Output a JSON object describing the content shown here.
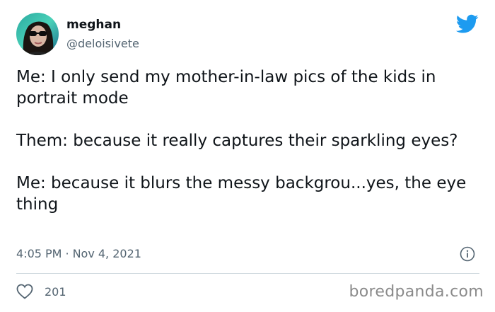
{
  "author": {
    "display_name": "meghan",
    "handle": "@deloisivete"
  },
  "tweet": {
    "paragraphs": [
      "Me: I only send my mother-in-law pics of the kids in portrait mode",
      "Them: because it really captures their sparkling eyes?",
      "Me: because it blurs the messy backgrou...yes, the eye thing"
    ],
    "time": "4:05 PM",
    "separator": "·",
    "date": "Nov 4, 2021"
  },
  "stats": {
    "likes": "201"
  },
  "watermark": "boredpanda.com",
  "colors": {
    "twitter_blue": "#1d9bf0",
    "secondary_text": "#536471",
    "divider": "#cfd9de"
  },
  "icons": [
    "twitter-bird-icon",
    "info-icon",
    "heart-icon"
  ]
}
